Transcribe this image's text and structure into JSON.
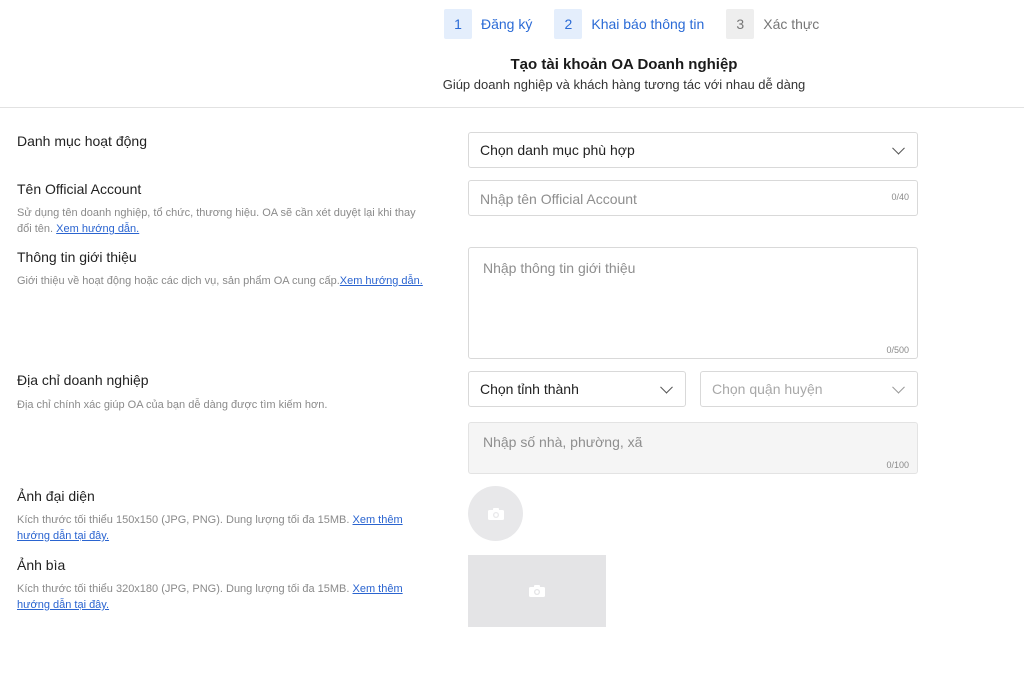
{
  "stepper": {
    "steps": [
      {
        "num": "1",
        "label": "Đăng ký"
      },
      {
        "num": "2",
        "label": "Khai báo thông tin"
      },
      {
        "num": "3",
        "label": "Xác thực"
      }
    ]
  },
  "header": {
    "title": "Tạo tài khoản OA Doanh nghiệp",
    "subtitle": "Giúp doanh nghiệp và khách hàng tương tác với nhau dễ dàng"
  },
  "form": {
    "category": {
      "label": "Danh mục hoạt động",
      "value": "Chọn danh mục phù hợp"
    },
    "oa_name": {
      "label": "Tên Official Account",
      "help": "Sử dụng tên doanh nghiệp, tổ chức, thương hiệu. OA sẽ cần xét duyệt lại khi thay đổi tên.",
      "help_link": "Xem hướng dẫn.",
      "placeholder": "Nhập tên Official Account",
      "counter": "0/40"
    },
    "intro": {
      "label": "Thông tin giới thiệu",
      "help": "Giới thiệu về hoạt động hoặc các dịch vụ, sản phẩm OA cung cấp.",
      "help_link": "Xem hướng dẫn.",
      "placeholder": "Nhập thông tin giới thiệu",
      "counter": "0/500"
    },
    "address": {
      "label": "Địa chỉ doanh nghiệp",
      "help": "Địa chỉ chính xác giúp OA của bạn dễ dàng được tìm kiếm hơn.",
      "province": "Chọn tỉnh thành",
      "district": "Chọn quận huyện",
      "street_placeholder": "Nhập số nhà, phường, xã",
      "counter": "0/100"
    },
    "avatar": {
      "label": "Ảnh đại diện",
      "help": "Kích thước tối thiểu 150x150 (JPG, PNG). Dung lượng tối đa 15MB.",
      "help_link": "Xem thêm hướng dẫn tại đây.",
      "icon": "camera-icon"
    },
    "cover": {
      "label": "Ảnh bìa",
      "help": "Kích thước tối thiểu 320x180 (JPG, PNG). Dung lượng tối đa 15MB.",
      "help_link": "Xem thêm hướng dẫn tại đây.",
      "icon": "camera-icon"
    }
  },
  "colors": {
    "accent": "#2b6bd6",
    "link": "#2a64d0"
  }
}
